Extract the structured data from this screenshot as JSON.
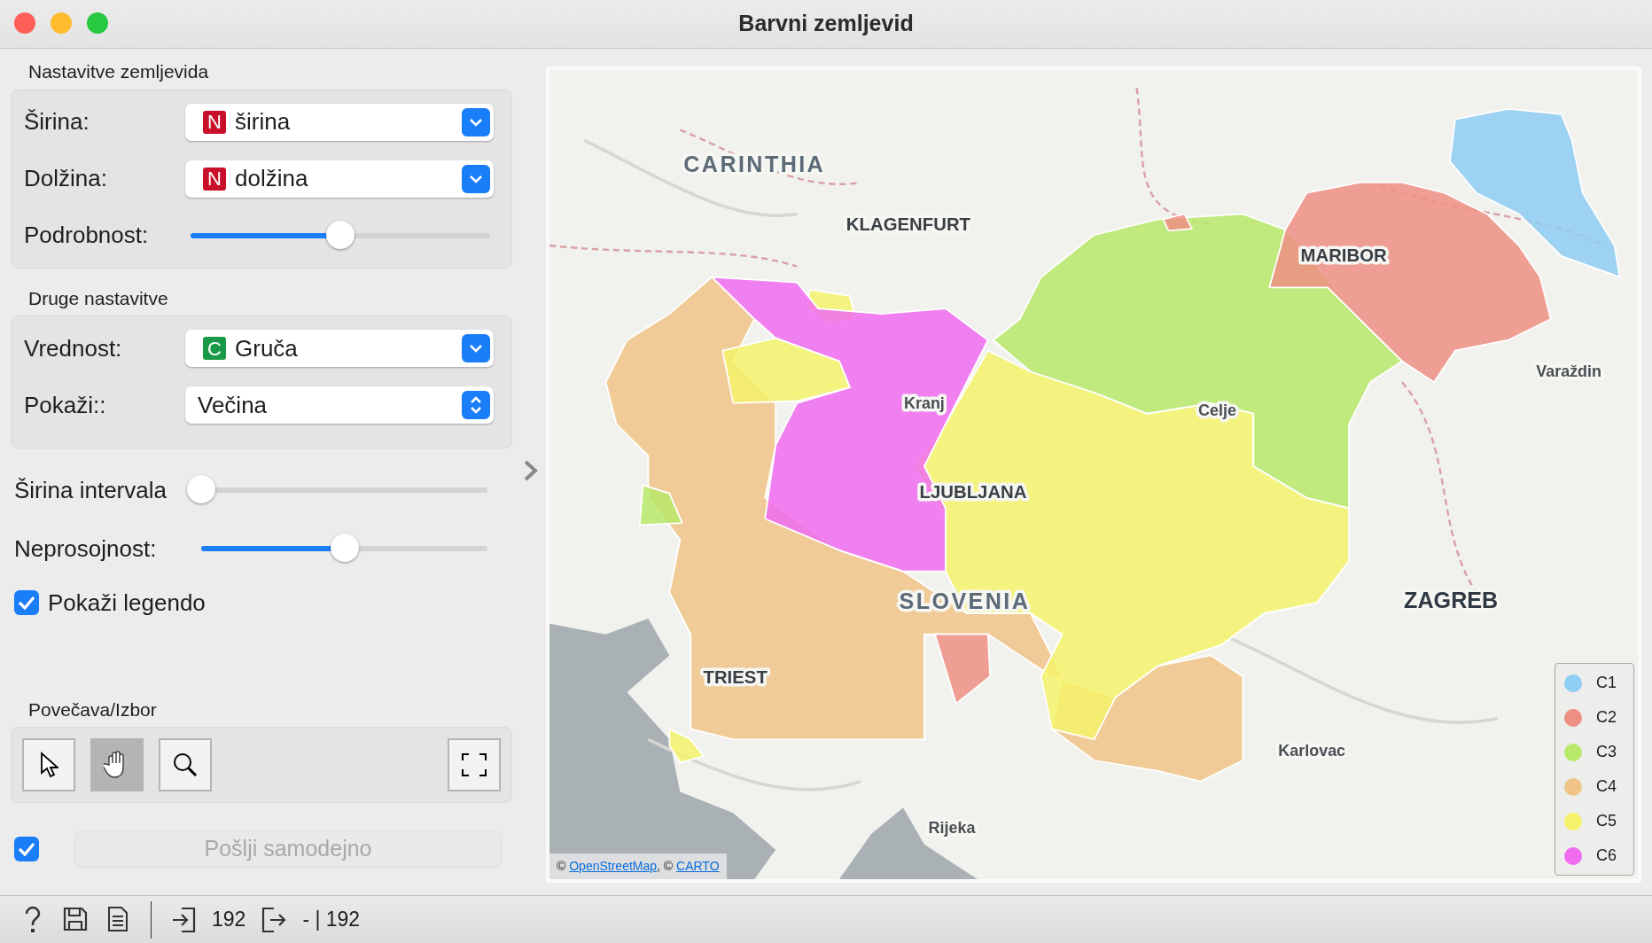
{
  "window": {
    "title": "Barvni zemljevid"
  },
  "map_settings": {
    "title": "Nastavitve zemljevida",
    "fields": [
      {
        "label": "Širina:",
        "kind": "numeric",
        "badge": "N",
        "value": "širina"
      },
      {
        "label": "Dolžina:",
        "kind": "numeric",
        "badge": "N",
        "value": "dolžina"
      }
    ],
    "detail": {
      "label": "Podrobnost:",
      "level": 0.5
    }
  },
  "other_settings": {
    "title": "Druge nastavitve",
    "value_field": {
      "label": "Vrednost:",
      "kind": "categorical",
      "badge": "C",
      "value": "Gruča"
    },
    "show_field": {
      "label": "Pokaži::",
      "value": "Večina"
    }
  },
  "interval_width": {
    "label": "Širina intervala",
    "level": 0
  },
  "opacity": {
    "label": "Neprosojnost:",
    "level": 0.5
  },
  "show_legend": {
    "label": "Pokaži legendo",
    "checked": true
  },
  "zoom_select": {
    "title": "Povečava/Izbor",
    "tools": [
      {
        "kind": "select",
        "selected": false
      },
      {
        "kind": "pan",
        "selected": true
      },
      {
        "kind": "zoom",
        "selected": false
      }
    ]
  },
  "auto_send": {
    "checked": true,
    "label": "Pošlji samodejno",
    "disabled": true
  },
  "map": {
    "labels": [
      {
        "text": "CARINTHIA",
        "kind": "region"
      },
      {
        "text": "KLAGENFURT",
        "kind": "city"
      },
      {
        "text": "MARIBOR",
        "kind": "city"
      },
      {
        "text": "Varaždin",
        "kind": "town"
      },
      {
        "text": "Kranj",
        "kind": "town"
      },
      {
        "text": "Celje",
        "kind": "town"
      },
      {
        "text": "LJUBLJANA",
        "kind": "city"
      },
      {
        "text": "SLOVENIA",
        "kind": "region"
      },
      {
        "text": "ZAGREB",
        "kind": "capital"
      },
      {
        "text": "TRIEST",
        "kind": "city"
      },
      {
        "text": "Karlovac",
        "kind": "town"
      },
      {
        "text": "Rijeka",
        "kind": "town"
      }
    ],
    "attribution": [
      {
        "kind": "text",
        "text": "© "
      },
      {
        "kind": "link",
        "text": "OpenStreetMap"
      },
      {
        "kind": "text",
        "text": ", © "
      },
      {
        "kind": "link",
        "text": "CARTO"
      }
    ],
    "legend": [
      {
        "label": "C1",
        "color": "#8fcdf2"
      },
      {
        "label": "C2",
        "color": "#ee8f84"
      },
      {
        "label": "C3",
        "color": "#b8e96a"
      },
      {
        "label": "C4",
        "color": "#f0c487"
      },
      {
        "label": "C5",
        "color": "#f4f36b"
      },
      {
        "label": "C6",
        "color": "#f06cf0"
      }
    ]
  },
  "status_bar": {
    "input_count": "192",
    "output_count": "- | 192"
  }
}
